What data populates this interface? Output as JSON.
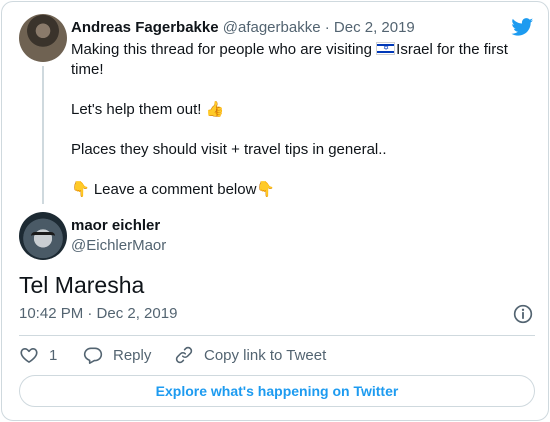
{
  "parent_tweet": {
    "author_name": "Andreas Fagerbakke",
    "handle": "@afagerbakke",
    "separator": "·",
    "date": "Dec 2, 2019",
    "line1_before_flag": "Making this thread for people who are visiting ",
    "flag_icon": "israel-flag-icon",
    "line1_after_flag": "Israel for the first time!",
    "line2": "Let's help them out! 👍",
    "line3": "Places they should visit + travel tips in general..",
    "line4": "👇 Leave a comment below👇"
  },
  "reply_tweet": {
    "author_name": "maor eichler",
    "handle": "@EichlerMaor",
    "text": "Tel Maresha",
    "timestamp": "10:42 PM · Dec 2, 2019"
  },
  "actions": {
    "like_count": "1",
    "reply_label": "Reply",
    "copy_label": "Copy link to Tweet"
  },
  "footer": {
    "explore_label": "Explore what's happening on Twitter"
  },
  "colors": {
    "brand": "#1d9bf0",
    "text": "#0f1419",
    "muted": "#536471",
    "border": "#cfd9de"
  },
  "icons": [
    "twitter-logo-icon",
    "info-icon",
    "heart-icon",
    "reply-icon",
    "link-icon"
  ]
}
